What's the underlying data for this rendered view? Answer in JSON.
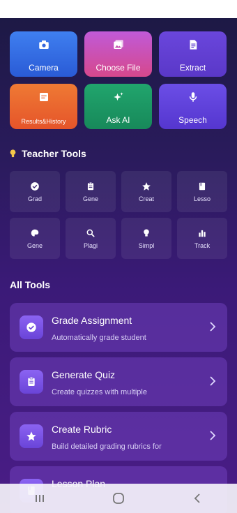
{
  "quick_actions": [
    {
      "label": "Camera",
      "icon": "camera-icon"
    },
    {
      "label": "Choose File",
      "icon": "image-icon"
    },
    {
      "label": "Extract",
      "icon": "document-icon"
    },
    {
      "label": "Results&History",
      "icon": "history-icon"
    },
    {
      "label": "Ask AI",
      "icon": "sparkle-icon"
    },
    {
      "label": "Speech",
      "icon": "microphone-icon"
    }
  ],
  "teacher_tools": {
    "title": "Teacher Tools",
    "items": [
      {
        "label": "Grad",
        "icon": "check-circle-icon"
      },
      {
        "label": "Gene",
        "icon": "clipboard-icon"
      },
      {
        "label": "Creat",
        "icon": "star-icon"
      },
      {
        "label": "Lesso",
        "icon": "book-icon"
      },
      {
        "label": "Gene",
        "icon": "palette-icon"
      },
      {
        "label": "Plagi",
        "icon": "search-icon"
      },
      {
        "label": "Simpl",
        "icon": "lightbulb-icon"
      },
      {
        "label": "Track",
        "icon": "bar-chart-icon"
      }
    ]
  },
  "all_tools": {
    "title": "All Tools",
    "items": [
      {
        "title": "Grade Assignment",
        "subtitle": "Automatically grade student",
        "icon": "check-circle-icon"
      },
      {
        "title": "Generate Quiz",
        "subtitle": "Create quizzes with multiple",
        "icon": "clipboard-icon"
      },
      {
        "title": "Create Rubric",
        "subtitle": "Build detailed grading rubrics for",
        "icon": "star-icon"
      },
      {
        "title": "Lesson Plan",
        "subtitle": "",
        "icon": "book-icon"
      }
    ]
  }
}
